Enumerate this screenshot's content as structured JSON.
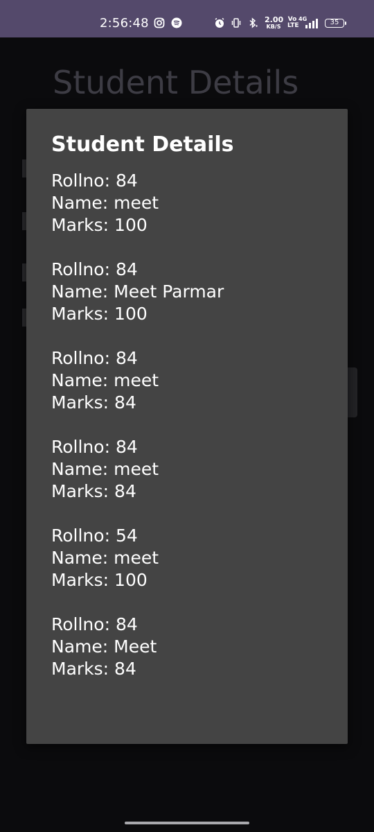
{
  "status_bar": {
    "time": "2:56:48",
    "net_speed_value": "2.00",
    "net_speed_unit": "KB/S",
    "volte_top": "Vo",
    "volte_bottom": "LTE",
    "network_type": "4G",
    "battery_level": "35",
    "icons": [
      "instagram-icon",
      "spotify-icon",
      "alarm-icon",
      "vibrate-icon",
      "bluetooth-icon",
      "signal-icon",
      "battery-icon"
    ]
  },
  "app": {
    "title": "Student Details"
  },
  "dialog": {
    "title": "Student Details",
    "records": [
      {
        "rollno": "Rollno: 84",
        "name": "Name: meet",
        "marks": "Marks: 100"
      },
      {
        "rollno": "Rollno: 84",
        "name": "Name: Meet Parmar",
        "marks": "Marks: 100"
      },
      {
        "rollno": "Rollno: 84",
        "name": "Name: meet",
        "marks": "Marks: 84"
      },
      {
        "rollno": "Rollno: 84",
        "name": "Name: meet",
        "marks": "Marks: 84"
      },
      {
        "rollno": "Rollno: 54",
        "name": "Name: meet",
        "marks": "Marks: 100"
      },
      {
        "rollno": "Rollno: 84",
        "name": "Name: Meet",
        "marks": "Marks: 84"
      }
    ]
  },
  "colors": {
    "status_bar_bg": "#54496b",
    "dialog_bg": "#444444",
    "screen_bg": "#0b0b0d"
  }
}
